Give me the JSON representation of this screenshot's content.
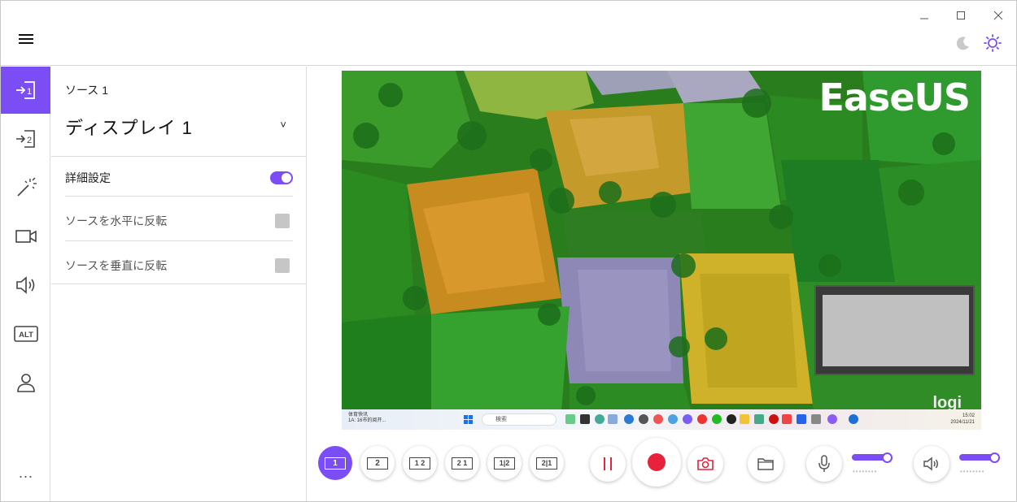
{
  "window": {
    "minimize": "—",
    "maximize": "☐",
    "close": "✕"
  },
  "rail": {
    "items": [
      {
        "name": "source-1",
        "icon": "input-1-icon"
      },
      {
        "name": "source-2",
        "icon": "input-2-icon"
      },
      {
        "name": "effects",
        "icon": "magic-wand-icon"
      },
      {
        "name": "camera",
        "icon": "camera-icon"
      },
      {
        "name": "audio",
        "icon": "speaker-icon"
      },
      {
        "name": "alt",
        "icon": "alt-icon",
        "label": "ALT"
      },
      {
        "name": "account",
        "icon": "user-icon"
      }
    ],
    "more": "···"
  },
  "panel": {
    "source_label": "ソース 1",
    "source_value": "ディスプレイ 1",
    "chevron": "˅",
    "advanced_label": "詳細設定",
    "advanced_on": true,
    "flip_h_label": "ソースを水平に反転",
    "flip_v_label": "ソースを垂直に反転"
  },
  "preview": {
    "logo": "EaseUS",
    "watermark": "logi",
    "taskbar": {
      "weather_title": "体育快讯",
      "weather_sub": "1A: 16市的阅开...",
      "search_placeholder": "検索",
      "time": "15:02",
      "date": "2024/11/21"
    }
  },
  "controls": {
    "layouts": [
      {
        "label": "1",
        "active": true
      },
      {
        "label": "2",
        "active": false
      },
      {
        "label": "1 2",
        "active": false
      },
      {
        "label": "2 1",
        "active": false
      },
      {
        "label": "1|2",
        "active": false
      },
      {
        "label": "2|1",
        "active": false
      }
    ],
    "pause_icon": "pause-icon",
    "record_icon": "record-icon",
    "screenshot_icon": "camera-icon",
    "folder_icon": "folder-icon",
    "mic_icon": "microphone-icon",
    "mic_level": 1.0,
    "speaker_icon": "speaker-icon",
    "speaker_level": 1.0
  },
  "colors": {
    "accent": "#7b4ef5",
    "record": "#e8213c"
  }
}
